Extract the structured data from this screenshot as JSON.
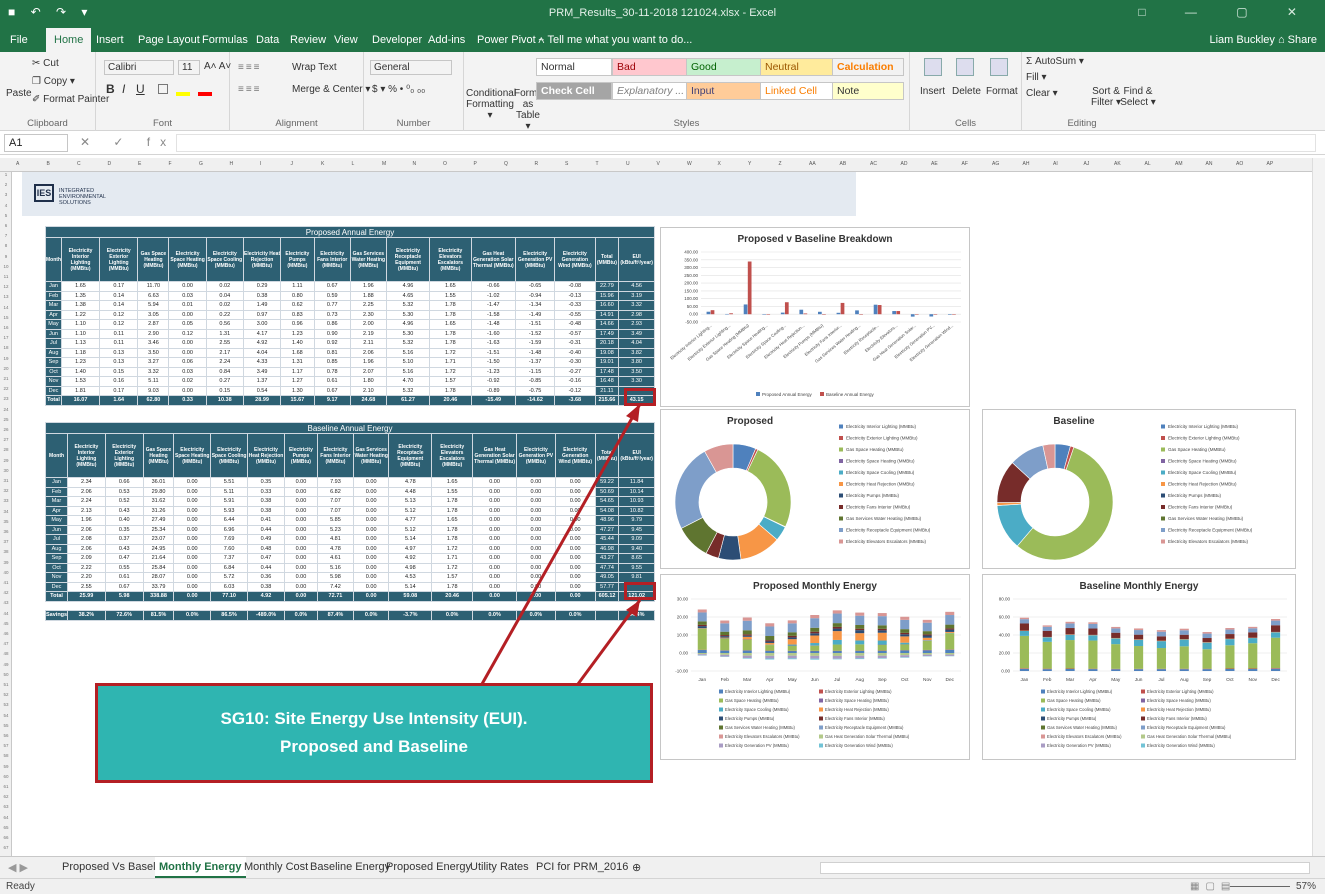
{
  "titlebar": {
    "title": "PRM_Results_30-11-2018 121024.xlsx - Excel",
    "quick_access": "■ ↶ ↷ ▾",
    "window_controls": "□ — ▢ ✕"
  },
  "tabs": [
    "File",
    "Home",
    "Insert",
    "Page Layout",
    "Formulas",
    "Data",
    "Review",
    "View",
    "Developer",
    "Add-ins",
    "Power Pivot",
    "⍲ Tell me what you want to do..."
  ],
  "user": "Liam Buckley  ⌂ Share",
  "ribbon": {
    "clipboard": {
      "paste": "Paste",
      "cut": "✂ Cut",
      "copy": "❐ Copy ▾",
      "format_painter": "✐ Format Painter",
      "label": "Clipboard"
    },
    "font": {
      "name": "Calibri",
      "size": "11",
      "grow": "A˄ A˅",
      "bold": "B",
      "italic": "I",
      "underline": "U",
      "label": "Font"
    },
    "alignment": {
      "wrap": "Wrap Text",
      "merge": "Merge & Center ▾",
      "label": "Alignment"
    },
    "number": {
      "format": "General",
      "symbols": "$ ▾ % • ⁰₀ ₀₀",
      "label": "Number"
    },
    "styles": {
      "cond": "Conditional Formatting ▾",
      "fmt_table": "Format as Table ▾",
      "normal": "Normal",
      "bad": "Bad",
      "good": "Good",
      "neutral": "Neutral",
      "calculation": "Calculation",
      "check": "Check Cell",
      "explanatory": "Explanatory ...",
      "input": "Input",
      "linked": "Linked Cell",
      "note": "Note",
      "label": "Styles"
    },
    "cells": {
      "insert": "Insert",
      "delete": "Delete",
      "format": "Format",
      "label": "Cells"
    },
    "editing": {
      "autosum": "Σ AutoSum ▾",
      "fill": "Fill ▾",
      "clear": "Clear ▾",
      "sort": "Sort & Filter ▾",
      "find": "Find & Select ▾",
      "label": "Editing"
    }
  },
  "formula_bar": {
    "name_box": "A1",
    "fx": "✕ ✓ fx",
    "value": ""
  },
  "columns": [
    "A",
    "B",
    "C",
    "D",
    "E",
    "F",
    "G",
    "H",
    "I",
    "J",
    "K",
    "L",
    "M",
    "N",
    "O",
    "P",
    "Q",
    "R",
    "S",
    "T",
    "U",
    "V",
    "W",
    "X",
    "Y",
    "Z",
    "AA",
    "AB",
    "AC",
    "AD",
    "AE",
    "AF",
    "AG",
    "AH",
    "AI",
    "AJ",
    "AK",
    "AL",
    "AM",
    "AN",
    "AO",
    "AP"
  ],
  "logo": {
    "mark": "IES",
    "text": "INTEGRATED ENVIRONMENTAL SOLUTIONS"
  },
  "headers": [
    "Month",
    "Electricity Interior Lighting (MMBtu)",
    "Electricity Exterior Lighting (MMBtu)",
    "Gas Space Heating (MMBtu)",
    "Electricity Space Heating (MMBtu)",
    "Electricity Space Cooling (MMBtu)",
    "Electricity Heat Rejection (MMBtu)",
    "Electricity Pumps (MMBtu)",
    "Electricity Fans Interior (MMBtu)",
    "Gas Services Water Heating (MMBtu)",
    "Electricity Receptacle Equipment (MMBtu)",
    "Electricity Elevators Escalators (MMBtu)",
    "Gas Heat Generation Solar Thermal (MMBtu)",
    "Electricity Generation PV (MMBtu)",
    "Electricity Generation Wind (MMBtu)",
    "Total (MMBtu)",
    "EUI (kBtu/ft²/year)"
  ],
  "proposed": {
    "title": "Proposed Annual Energy",
    "rows": [
      [
        "Jan",
        "1.65",
        "0.17",
        "11.70",
        "0.00",
        "0.02",
        "0.29",
        "1.11",
        "0.67",
        "1.96",
        "4.96",
        "1.65",
        "-0.66",
        "-0.65",
        "-0.08",
        "22.79",
        "4.56"
      ],
      [
        "Feb",
        "1.35",
        "0.14",
        "6.63",
        "0.03",
        "0.04",
        "0.38",
        "0.80",
        "0.59",
        "1.88",
        "4.65",
        "1.55",
        "-1.02",
        "-0.94",
        "-0.13",
        "15.96",
        "3.19"
      ],
      [
        "Mar",
        "1.38",
        "0.14",
        "5.94",
        "0.01",
        "0.02",
        "1.49",
        "0.62",
        "0.77",
        "2.25",
        "5.32",
        "1.78",
        "-1.47",
        "-1.34",
        "-0.33",
        "16.60",
        "3.32"
      ],
      [
        "Apr",
        "1.22",
        "0.12",
        "3.05",
        "0.00",
        "0.22",
        "0.97",
        "0.83",
        "0.73",
        "2.30",
        "5.30",
        "1.78",
        "-1.58",
        "-1.49",
        "-0.55",
        "14.91",
        "2.98"
      ],
      [
        "May",
        "1.10",
        "0.12",
        "2.87",
        "0.05",
        "0.56",
        "3.00",
        "0.96",
        "0.86",
        "2.00",
        "4.96",
        "1.65",
        "-1.48",
        "-1.51",
        "-0.48",
        "14.66",
        "2.93"
      ],
      [
        "Jun",
        "1.10",
        "0.11",
        "2.90",
        "0.12",
        "1.31",
        "4.17",
        "1.23",
        "0.90",
        "2.19",
        "5.30",
        "1.78",
        "-1.60",
        "-1.52",
        "-0.57",
        "17.49",
        "3.49"
      ],
      [
        "Jul",
        "1.13",
        "0.11",
        "3.46",
        "0.00",
        "2.55",
        "4.92",
        "1.40",
        "0.92",
        "2.11",
        "5.32",
        "1.78",
        "-1.63",
        "-1.59",
        "-0.31",
        "20.18",
        "4.04"
      ],
      [
        "Aug",
        "1.18",
        "0.13",
        "3.50",
        "0.00",
        "2.17",
        "4.04",
        "1.68",
        "0.81",
        "2.06",
        "5.16",
        "1.72",
        "-1.51",
        "-1.48",
        "-0.40",
        "19.08",
        "3.82"
      ],
      [
        "Sep",
        "1.23",
        "0.13",
        "3.27",
        "0.06",
        "2.24",
        "4.33",
        "1.31",
        "0.85",
        "1.96",
        "5.10",
        "1.71",
        "-1.50",
        "-1.37",
        "-0.30",
        "19.01",
        "3.80"
      ],
      [
        "Oct",
        "1.40",
        "0.15",
        "3.32",
        "0.03",
        "0.84",
        "3.49",
        "1.17",
        "0.78",
        "2.07",
        "5.16",
        "1.72",
        "-1.23",
        "-1.15",
        "-0.27",
        "17.48",
        "3.50"
      ],
      [
        "Nov",
        "1.53",
        "0.16",
        "5.11",
        "0.02",
        "0.27",
        "1.37",
        "1.27",
        "0.61",
        "1.80",
        "4.70",
        "1.57",
        "-0.92",
        "-0.85",
        "-0.16",
        "16.48",
        "3.30"
      ],
      [
        "Dec",
        "1.81",
        "0.17",
        "9.03",
        "0.00",
        "0.15",
        "0.54",
        "1.30",
        "0.67",
        "2.10",
        "5.32",
        "1.78",
        "-0.89",
        "-0.75",
        "-0.12",
        "21.11",
        ""
      ]
    ],
    "total": [
      "Total",
      "16.07",
      "1.64",
      "62.80",
      "0.33",
      "10.38",
      "28.99",
      "15.67",
      "9.17",
      "24.68",
      "61.27",
      "20.46",
      "-15.49",
      "-14.62",
      "-3.68",
      "215.66",
      "43.15"
    ]
  },
  "baseline": {
    "title": "Baseline Annual Energy",
    "rows": [
      [
        "Jan",
        "2.34",
        "0.66",
        "36.01",
        "0.00",
        "5.51",
        "0.35",
        "0.00",
        "7.93",
        "0.00",
        "4.78",
        "1.65",
        "0.00",
        "0.00",
        "0.00",
        "59.22",
        "11.84"
      ],
      [
        "Feb",
        "2.06",
        "0.53",
        "29.80",
        "0.00",
        "5.11",
        "0.33",
        "0.00",
        "6.82",
        "0.00",
        "4.48",
        "1.55",
        "0.00",
        "0.00",
        "0.00",
        "50.69",
        "10.14"
      ],
      [
        "Mar",
        "2.24",
        "0.52",
        "31.62",
        "0.00",
        "5.91",
        "0.38",
        "0.00",
        "7.07",
        "0.00",
        "5.13",
        "1.78",
        "0.00",
        "0.00",
        "0.00",
        "54.65",
        "10.93"
      ],
      [
        "Apr",
        "2.13",
        "0.43",
        "31.26",
        "0.00",
        "5.93",
        "0.38",
        "0.00",
        "7.07",
        "0.00",
        "5.12",
        "1.78",
        "0.00",
        "0.00",
        "0.00",
        "54.08",
        "10.82"
      ],
      [
        "May",
        "1.96",
        "0.40",
        "27.49",
        "0.00",
        "6.44",
        "0.41",
        "0.00",
        "5.85",
        "0.00",
        "4.77",
        "1.65",
        "0.00",
        "0.00",
        "0.00",
        "48.96",
        "9.79"
      ],
      [
        "Jun",
        "2.06",
        "0.35",
        "25.34",
        "0.00",
        "6.96",
        "0.44",
        "0.00",
        "5.23",
        "0.00",
        "5.12",
        "1.78",
        "0.00",
        "0.00",
        "0.00",
        "47.27",
        "9.45"
      ],
      [
        "Jul",
        "2.08",
        "0.37",
        "23.07",
        "0.00",
        "7.69",
        "0.49",
        "0.00",
        "4.81",
        "0.00",
        "5.14",
        "1.78",
        "0.00",
        "0.00",
        "0.00",
        "45.44",
        "9.09"
      ],
      [
        "Aug",
        "2.06",
        "0.43",
        "24.95",
        "0.00",
        "7.60",
        "0.48",
        "0.00",
        "4.78",
        "0.00",
        "4.97",
        "1.72",
        "0.00",
        "0.00",
        "0.00",
        "46.98",
        "9.40"
      ],
      [
        "Sep",
        "2.09",
        "0.47",
        "21.64",
        "0.00",
        "7.37",
        "0.47",
        "0.00",
        "4.61",
        "0.00",
        "4.92",
        "1.71",
        "0.00",
        "0.00",
        "0.00",
        "43.27",
        "8.65"
      ],
      [
        "Oct",
        "2.22",
        "0.55",
        "25.84",
        "0.00",
        "6.84",
        "0.44",
        "0.00",
        "5.16",
        "0.00",
        "4.98",
        "1.72",
        "0.00",
        "0.00",
        "0.00",
        "47.74",
        "9.55"
      ],
      [
        "Nov",
        "2.20",
        "0.61",
        "28.07",
        "0.00",
        "5.72",
        "0.36",
        "0.00",
        "5.98",
        "0.00",
        "4.53",
        "1.57",
        "0.00",
        "0.00",
        "0.00",
        "49.05",
        "9.81"
      ],
      [
        "Dec",
        "2.55",
        "0.67",
        "33.79",
        "0.00",
        "6.03",
        "0.38",
        "0.00",
        "7.42",
        "0.00",
        "5.14",
        "1.78",
        "0.00",
        "0.00",
        "0.00",
        "57.77",
        ""
      ]
    ],
    "total": [
      "Total",
      "25.99",
      "5.98",
      "338.88",
      "0.00",
      "77.10",
      "4.92",
      "0.00",
      "72.71",
      "0.00",
      "59.08",
      "20.46",
      "0.00",
      "0.00",
      "0.00",
      "605.12",
      "121.02"
    ],
    "savings": [
      "Savings",
      "38.2%",
      "72.6%",
      "81.5%",
      "0.0%",
      "86.5%",
      "-489.0%",
      "0.0%",
      "87.4%",
      "0.0%",
      "-3.7%",
      "0.0%",
      "0.0%",
      "0.0%",
      "0.0%",
      "",
      "64.4%"
    ]
  },
  "callout": {
    "line1": "SG10: Site Energy Use Intensity (EUI).",
    "line2": "Proposed and Baseline"
  },
  "colors": {
    "excel_green": "#217346",
    "table_header": "#2d6073",
    "callout_fill": "#2fb5b1",
    "callout_border": "#b41f24",
    "proposed_series": "#4f81bd",
    "baseline_series": "#c0504d"
  },
  "chart_data": [
    {
      "type": "bar",
      "title": "Proposed v Baseline Breakdown",
      "categories": [
        "Electricity Interior Lighting...",
        "Electricity Exterior Lighting...",
        "Gas Space Heating (MMBtu)",
        "Electricity Space Heating...",
        "Electricity Space Cooling...",
        "Electricity Heat Rejection...",
        "Electricity Pumps (MMBtu)",
        "Electricity Fans Interior...",
        "Gas Services Water Heating...",
        "Electricity Receptacle...",
        "Electricity Elevators...",
        "Gas Heat Generation Solar...",
        "Electricity Generation PV...",
        "Electricity Generation Wind..."
      ],
      "series": [
        {
          "name": "Proposed Annual Energy",
          "values": [
            16.07,
            1.64,
            62.8,
            0.33,
            10.38,
            28.99,
            15.67,
            9.17,
            24.68,
            61.27,
            20.46,
            -15.49,
            -14.62,
            -3.68
          ]
        },
        {
          "name": "Baseline Annual Energy",
          "values": [
            25.99,
            5.98,
            338.88,
            0,
            77.1,
            4.92,
            0,
            72.71,
            0,
            59.08,
            20.46,
            0,
            0,
            0
          ]
        }
      ],
      "y_ticks": [
        "400.00",
        "350.00",
        "300.00",
        "250.00",
        "200.00",
        "150.00",
        "100.00",
        "50.00",
        "0.00",
        "-50.00"
      ],
      "ylim": [
        -50,
        400
      ],
      "legend": "bottom"
    },
    {
      "type": "pie",
      "title": "Proposed",
      "donut": true,
      "labels": [
        "Electricity Interior Lighting (MMBtu)",
        "Electricity Exterior Lighting (MMBtu)",
        "Gas Space Heating (MMBtu)",
        "Electricity Space Heating (MMBtu)",
        "Electricity Space Cooling (MMBtu)",
        "Electricity Heat Rejection (MMBtu)",
        "Electricity Pumps (MMBtu)",
        "Electricity Fans Interior (MMBtu)",
        "Gas Services Water Heating (MMBtu)",
        "Electricity Receptacle Equipment (MMBtu)",
        "Electricity Elevators Escalators (MMBtu)"
      ],
      "values": [
        16.07,
        1.64,
        62.8,
        0.33,
        10.38,
        28.99,
        15.67,
        9.17,
        24.68,
        61.27,
        20.46
      ],
      "legend": "right"
    },
    {
      "type": "pie",
      "title": "Baseline",
      "donut": true,
      "labels": [
        "Electricity Interior Lighting (MMBtu)",
        "Electricity Exterior Lighting (MMBtu)",
        "Gas Space Heating (MMBtu)",
        "Electricity Space Heating (MMBtu)",
        "Electricity Space Cooling (MMBtu)",
        "Electricity Heat Rejection (MMBtu)",
        "Electricity Pumps (MMBtu)",
        "Electricity Fans Interior (MMBtu)",
        "Gas Services Water Heating (MMBtu)",
        "Electricity Receptacle Equipment (MMBtu)",
        "Electricity Elevators Escalators (MMBtu)"
      ],
      "values": [
        25.99,
        5.98,
        338.88,
        0,
        77.1,
        4.92,
        0,
        72.71,
        0,
        59.08,
        20.46
      ],
      "legend": "right"
    },
    {
      "type": "bar",
      "stacked": true,
      "title": "Proposed Monthly Energy",
      "categories": [
        "Jan",
        "Feb",
        "Mar",
        "Apr",
        "May",
        "Jun",
        "Jul",
        "Aug",
        "Sep",
        "Oct",
        "Nov",
        "Dec"
      ],
      "totals": [
        22.79,
        15.96,
        16.6,
        14.91,
        14.66,
        17.49,
        20.18,
        19.08,
        19.01,
        17.48,
        16.48,
        21.11
      ],
      "y_ticks": [
        "30.00",
        "20.00",
        "10.00",
        "0.00",
        "-10.00"
      ],
      "ylim": [
        -10,
        30
      ],
      "legend": "bottom",
      "series_names": [
        "Electricity Interior Lighting (MMBtu)",
        "Electricity Exterior Lighting (MMBtu)",
        "Gas Space Heating (MMBtu)",
        "Electricity Space Heating (MMBtu)",
        "Electricity Space Cooling (MMBtu)",
        "Electricity Heat Rejection (MMBtu)",
        "Electricity Pumps (MMBtu)",
        "Electricity Fans Interior (MMBtu)",
        "Gas Services Water Heating (MMBtu)",
        "Electricity Receptacle Equipment (MMBtu)",
        "Electricity Elevators Escalators (MMBtu)",
        "Gas Heat Generation Solar Thermal (MMBtu)",
        "Electricity Generation PV (MMBtu)",
        "Electricity Generation Wind (MMBtu)"
      ]
    },
    {
      "type": "bar",
      "stacked": true,
      "title": "Baseline Monthly Energy",
      "categories": [
        "Jan",
        "Feb",
        "Mar",
        "Apr",
        "May",
        "Jun",
        "Jul",
        "Aug",
        "Sep",
        "Oct",
        "Nov",
        "Dec"
      ],
      "totals": [
        59.22,
        50.69,
        54.65,
        54.08,
        48.96,
        47.27,
        45.44,
        46.98,
        43.27,
        47.74,
        49.05,
        57.77
      ],
      "y_ticks": [
        "80.00",
        "60.00",
        "40.00",
        "20.00",
        "0.00"
      ],
      "ylim": [
        0,
        80
      ],
      "legend": "bottom",
      "series_names": [
        "Electricity Interior Lighting (MMBtu)",
        "Electricity Exterior Lighting (MMBtu)",
        "Gas Space Heating (MMBtu)",
        "Electricity Space Heating (MMBtu)",
        "Electricity Space Cooling (MMBtu)",
        "Electricity Heat Rejection (MMBtu)",
        "Electricity Pumps (MMBtu)",
        "Electricity Fans Interior (MMBtu)",
        "Gas Services Water Heating (MMBtu)",
        "Electricity Receptacle Equipment (MMBtu)",
        "Electricity Elevators Escalators (MMBtu)",
        "Gas Heat Generation Solar Thermal (MMBtu)",
        "Electricity Generation PV (MMBtu)",
        "Electricity Generation Wind (MMBtu)"
      ]
    }
  ],
  "palette": [
    "#4f81bd",
    "#c0504d",
    "#9bbb59",
    "#8064a2",
    "#4bacc6",
    "#f79646",
    "#2c4d75",
    "#772c2a",
    "#5f7530",
    "#7e9ec9",
    "#d99694",
    "#b3c98a",
    "#a99cc4",
    "#72c3d6"
  ],
  "sheet_tabs": [
    "Proposed Vs Baseline",
    "Monthly Energy",
    "Monthly Cost",
    "Baseline Energy",
    "Proposed Energy",
    "Utility Rates",
    "PCI for PRM_2016",
    "⊕"
  ],
  "status": {
    "ready": "Ready",
    "zoom": "57%"
  }
}
